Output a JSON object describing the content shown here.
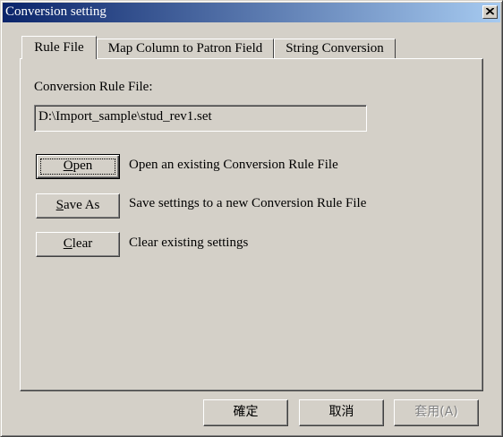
{
  "window": {
    "title": "Conversion setting"
  },
  "tabs": [
    {
      "label": "Rule File"
    },
    {
      "label": "Map Column to Patron Field"
    },
    {
      "label": "String Conversion"
    }
  ],
  "rule_file": {
    "field_label": "Conversion Rule File:",
    "path_value": "D:\\Import_sample\\stud_rev1.set",
    "actions": [
      {
        "button_label": "Open",
        "mnemonic": "O",
        "rest": "pen",
        "description": "Open an existing Conversion Rule File"
      },
      {
        "button_label": "Save As",
        "mnemonic": "S",
        "rest": "ave As",
        "description": "Save settings to a new Conversion Rule File"
      },
      {
        "button_label": "Clear",
        "mnemonic": "C",
        "rest": "lear",
        "description": "Clear existing settings"
      }
    ]
  },
  "footer": {
    "ok_label": "確定",
    "cancel_label": "取消",
    "apply_label": "套用(A)"
  },
  "icons": {
    "close": "close-icon"
  }
}
